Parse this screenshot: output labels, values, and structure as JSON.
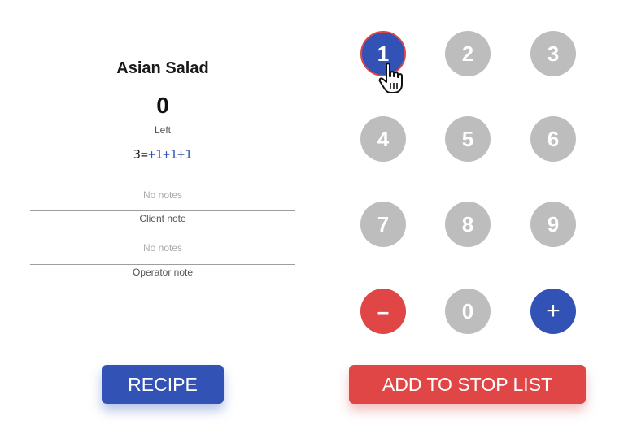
{
  "item": {
    "title": "Asian Salad",
    "count": "0",
    "count_label": "Left",
    "formula_base": "3=",
    "formula_adds": "+1+1+1"
  },
  "notes": {
    "client": {
      "text": "No notes",
      "label": "Client note"
    },
    "operator": {
      "text": "No notes",
      "label": "Operator note"
    }
  },
  "keypad": {
    "keys": [
      "1",
      "2",
      "3",
      "4",
      "5",
      "6",
      "7",
      "8",
      "9",
      "–",
      "0",
      "+"
    ],
    "selected": "1"
  },
  "buttons": {
    "recipe": "RECIPE",
    "stop_list": "ADD TO STOP LIST"
  },
  "colors": {
    "primary": "#3253b5",
    "danger": "#e04646",
    "key_inactive": "#bdbdbd"
  },
  "icons": {
    "cursor": "hand-pointer-icon"
  }
}
